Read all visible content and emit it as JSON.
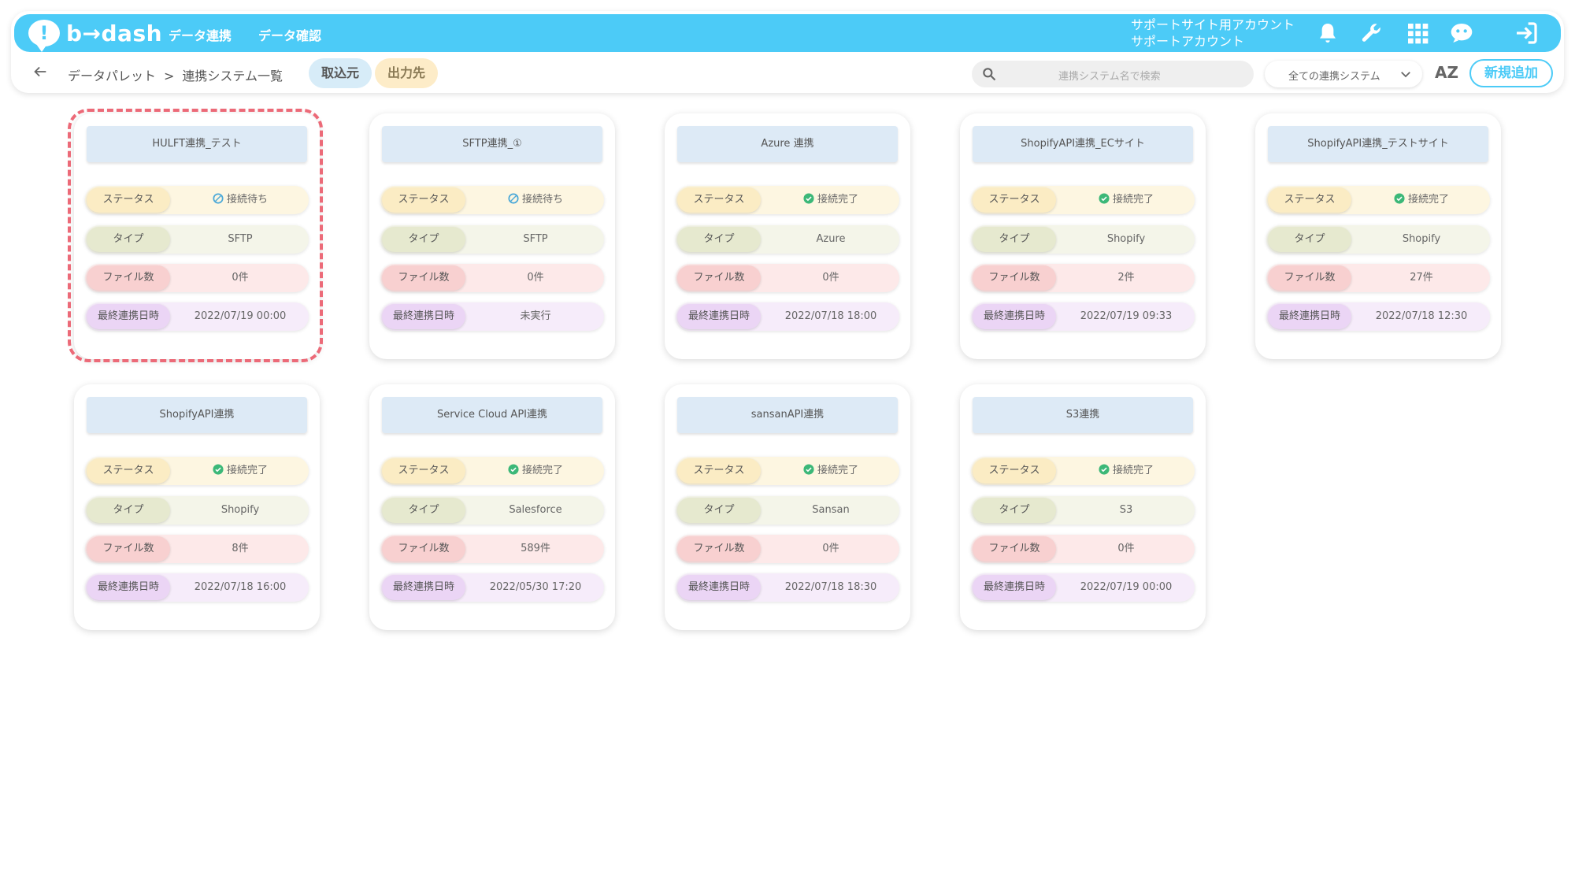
{
  "app": {
    "logo_text": "b→dash"
  },
  "header": {
    "nav": [
      "データ連携",
      "データ確認"
    ],
    "account_line1": "サポートサイト用アカウント",
    "account_line2": "サポートアカウント"
  },
  "subbar": {
    "breadcrumb": [
      "データパレット",
      "連携システム一覧"
    ],
    "breadcrumb_sep": ">",
    "tab_import": "取込元",
    "tab_export": "出力先",
    "search_placeholder": "連携システム名で検索",
    "filter_value": "全ての連携システム",
    "sort_label": "AZ",
    "new_button": "新規追加"
  },
  "labels": {
    "status": "ステータス",
    "type": "タイプ",
    "files": "ファイル数",
    "last": "最終連携日時"
  },
  "cards": [
    {
      "title": "HULFT連携_テスト",
      "status": "接続待ち",
      "status_kind": "waiting",
      "type": "SFTP",
      "files": "0件",
      "last": "2022/07/19 00:00"
    },
    {
      "title": "SFTP連携_①",
      "status": "接続待ち",
      "status_kind": "waiting",
      "type": "SFTP",
      "files": "0件",
      "last": "未実行"
    },
    {
      "title": "Azure 連携",
      "status": "接続完了",
      "status_kind": "done",
      "type": "Azure",
      "files": "0件",
      "last": "2022/07/18 18:00"
    },
    {
      "title": "ShopifyAPI連携_ECサイト",
      "status": "接続完了",
      "status_kind": "done",
      "type": "Shopify",
      "files": "2件",
      "last": "2022/07/19 09:33"
    },
    {
      "title": "ShopifyAPI連携_テストサイト",
      "status": "接続完了",
      "status_kind": "done",
      "type": "Shopify",
      "files": "27件",
      "last": "2022/07/18 12:30"
    },
    {
      "title": "ShopifyAPI連携",
      "status": "接続完了",
      "status_kind": "done",
      "type": "Shopify",
      "files": "8件",
      "last": "2022/07/18 16:00"
    },
    {
      "title": "Service Cloud API連携",
      "status": "接続完了",
      "status_kind": "done",
      "type": "Salesforce",
      "files": "589件",
      "last": "2022/05/30 17:20"
    },
    {
      "title": "sansanAPI連携",
      "status": "接続完了",
      "status_kind": "done",
      "type": "Sansan",
      "files": "0件",
      "last": "2022/07/18 18:30"
    },
    {
      "title": "S3連携",
      "status": "接続完了",
      "status_kind": "done",
      "type": "S3",
      "files": "0件",
      "last": "2022/07/19 00:00"
    }
  ],
  "colors": {
    "header": "#4ccbf7",
    "done": "#3cb878",
    "waiting": "#4ca9d8",
    "highlight": "#ec6a78"
  },
  "icons": [
    "back-arrow-icon",
    "bell-icon",
    "wrench-icon",
    "grid-icon",
    "chat-bot-icon",
    "logout-icon",
    "search-icon",
    "chevron-down-icon",
    "status-done-icon",
    "status-waiting-icon"
  ]
}
